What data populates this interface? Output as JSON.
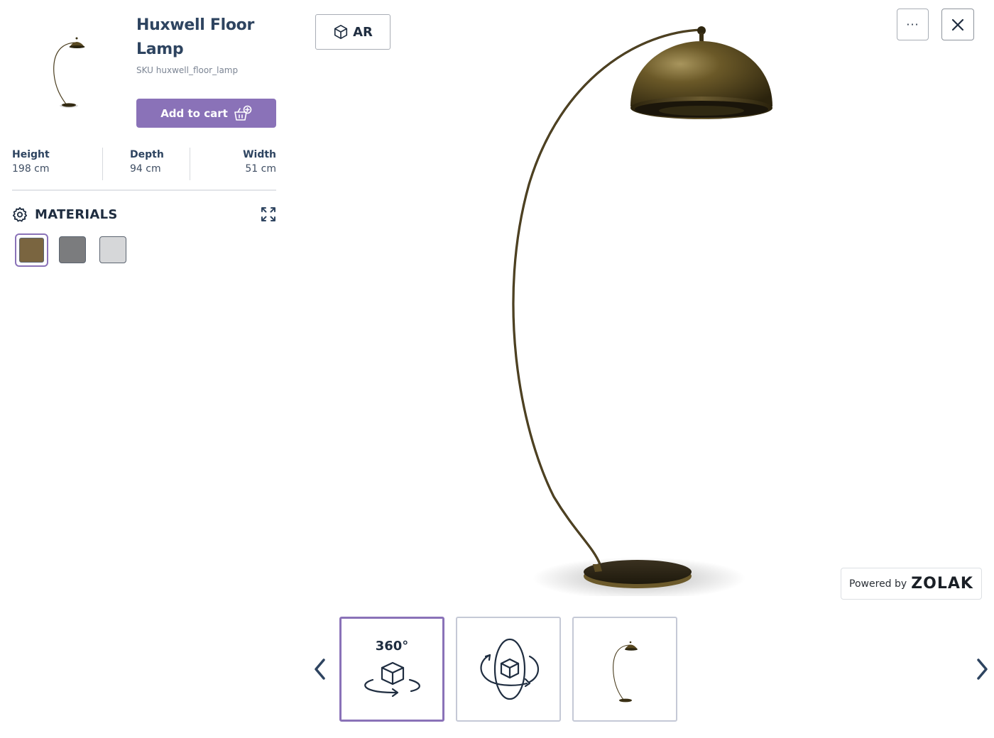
{
  "product": {
    "title": "Huxwell Floor Lamp",
    "sku": "SKU huxwell_floor_lamp",
    "add_to_cart_label": "Add to cart"
  },
  "dimensions": {
    "height": {
      "label": "Height",
      "value": "198 cm"
    },
    "depth": {
      "label": "Depth",
      "value": "94 cm"
    },
    "width": {
      "label": "Width",
      "value": "51 cm"
    }
  },
  "materials": {
    "title": "MATERIALS",
    "swatches": [
      {
        "name": "bronze",
        "color": "#7a6540",
        "selected": true
      },
      {
        "name": "graphite",
        "color": "#7b7c7e",
        "selected": false
      },
      {
        "name": "silver",
        "color": "#d6d7d9",
        "selected": false
      }
    ]
  },
  "toolbar": {
    "ar_label": "AR",
    "more_label": "···"
  },
  "branding": {
    "powered_by": "Powered by",
    "logo_text": "ZOLAK"
  },
  "carousel": {
    "tiles": [
      {
        "name": "360-view",
        "label": "360°",
        "active": true
      },
      {
        "name": "orbit-view",
        "active": false
      },
      {
        "name": "product-thumbnail",
        "active": false
      }
    ]
  },
  "colors": {
    "accent": "#8a72b8",
    "title": "#2e4460",
    "lamp_bronze": "#5a4a22"
  }
}
